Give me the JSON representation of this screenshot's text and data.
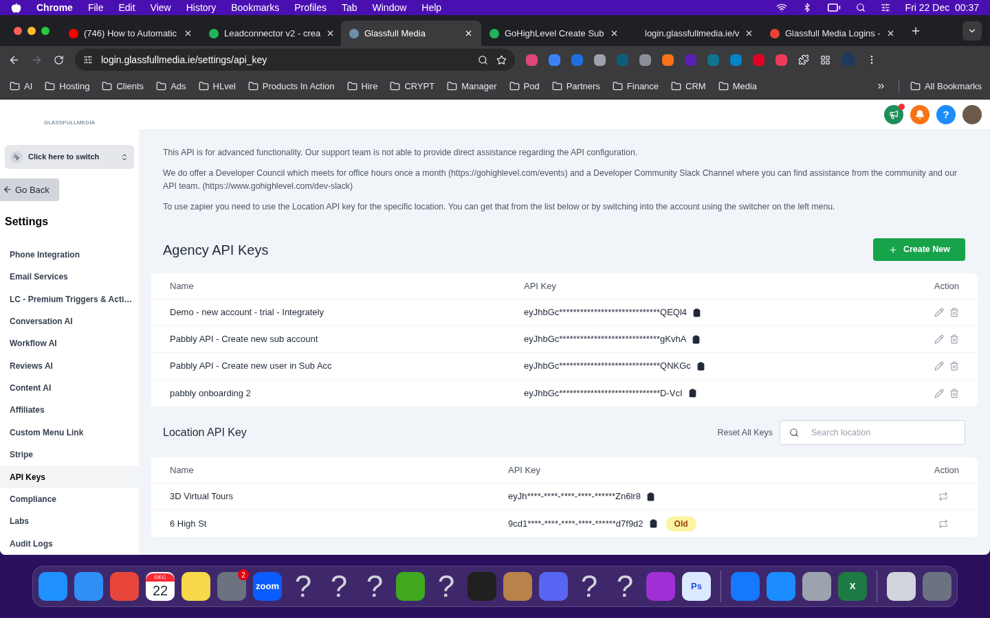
{
  "menu_bar": {
    "app": "Chrome",
    "items": [
      "File",
      "Edit",
      "View",
      "History",
      "Bookmarks",
      "Profiles",
      "Tab",
      "Window",
      "Help"
    ],
    "clock": "Fri 22 Dec  00:37"
  },
  "tabs": [
    {
      "title": "(746) How to Automatic",
      "selected": false,
      "color": "#ff0000"
    },
    {
      "title": "Leadconnector v2 - crea",
      "selected": false,
      "color": "#22b35e"
    },
    {
      "title": "Glassfull Media",
      "selected": true,
      "color": "#6b8fa8"
    },
    {
      "title": "GoHighLevel Create Sub",
      "selected": false,
      "color": "#22b35e"
    },
    {
      "title": "login.glassfullmedia.ie/v",
      "selected": false
    },
    {
      "title": "Glassfull Media Logins -",
      "selected": false,
      "color": "#ea4335"
    }
  ],
  "address": "login.glassfullmedia.ie/settings/api_key",
  "extensions": [
    {
      "color": "#e0457b"
    },
    {
      "color": "#3b82f6"
    },
    {
      "color": "#1d6fe0"
    },
    {
      "color": "#9ca3af"
    },
    {
      "color": "#0f5e78"
    },
    {
      "color": "#8b8f99"
    },
    {
      "color": "#f97316"
    },
    {
      "color": "#5b21b6"
    },
    {
      "color": "#0e7490"
    },
    {
      "color": "#0284c7"
    },
    {
      "color": "#e60023"
    },
    {
      "color": "#ef3b5b"
    }
  ],
  "bookmarks": [
    "AI",
    "Hosting",
    "Clients",
    "Ads",
    "HLvel",
    "Products In Action",
    "Hire",
    "CRYPT",
    "Manager",
    "Pod",
    "Partners",
    "Finance",
    "CRM",
    "Media"
  ],
  "all_bookmarks": "All Bookmarks",
  "sidebar": {
    "logo": "GLASSFULLMEDIA",
    "switcher": "Click here to switch",
    "back": "Go Back",
    "heading": "Settings",
    "items": [
      {
        "label": "Phone Integration",
        "selected": false
      },
      {
        "label": "Email Services",
        "selected": false
      },
      {
        "label": "LC - Premium Triggers & Acti…",
        "selected": false
      },
      {
        "label": "Conversation AI",
        "selected": false
      },
      {
        "label": "Workflow AI",
        "selected": false
      },
      {
        "label": "Reviews AI",
        "selected": false
      },
      {
        "label": "Content AI",
        "selected": false
      },
      {
        "label": "Affiliates",
        "selected": false
      },
      {
        "label": "Custom Menu Link",
        "selected": false
      },
      {
        "label": "Stripe",
        "selected": false
      },
      {
        "label": "API Keys",
        "selected": true
      },
      {
        "label": "Compliance",
        "selected": false
      },
      {
        "label": "Labs",
        "selected": false
      },
      {
        "label": "Audit Logs",
        "selected": false
      }
    ]
  },
  "header": {
    "help": "?",
    "notification_dot": true
  },
  "intro": [
    "This API is for advanced functionality. Our support team is not able to provide direct assistance regarding the API configuration.",
    "We do offer a Developer Council which meets for office hours once a month (https://gohighlevel.com/events) and a Developer Community Slack Channel where you can find assistance from the community and our API team. (https://www.gohighlevel.com/dev-slack)",
    "To use zapier you need to use the Location API key for the specific location. You can get that from the list below or by switching into the account using the switcher on the left menu."
  ],
  "agency": {
    "title": "Agency API Keys",
    "create_button": "Create New",
    "columns": [
      "Name",
      "API Key",
      "Action"
    ],
    "rows": [
      {
        "name": "Demo - new account - trial - Integrately",
        "key": "eyJhbGc*****************************QEQl4"
      },
      {
        "name": "Pabbly API - Create new sub account",
        "key": "eyJhbGc*****************************gKvhA"
      },
      {
        "name": "Pabbly API - Create new user in Sub Acc",
        "key": "eyJhbGc*****************************QNKGc"
      },
      {
        "name": "pabbly onboarding 2",
        "key": "eyJhbGc*****************************D-VcI"
      }
    ]
  },
  "location": {
    "title": "Location API Key",
    "reset": "Reset All Keys",
    "search_placeholder": "Search location",
    "columns": [
      "Name",
      "API Key",
      "Action"
    ],
    "rows": [
      {
        "name": "3D Virtual Tours",
        "key": "eyJh****-****-****-****-******Zn6lr8"
      },
      {
        "name": "6 High St",
        "key": "9cd1****-****-****-****-******d7f9d2",
        "badge": "Old"
      }
    ]
  },
  "dock": [
    {
      "kind": "app",
      "color": "#1e90ff"
    },
    {
      "kind": "app",
      "color": "#2f8ff5"
    },
    {
      "kind": "app",
      "color": "#e8463a"
    },
    {
      "kind": "calendar",
      "month": "DEC",
      "day": "22"
    },
    {
      "kind": "app",
      "color": "#f8d84a"
    },
    {
      "kind": "app",
      "color": "#6b7280",
      "badge": "2"
    },
    {
      "kind": "label",
      "color": "#0b5cff",
      "text": "zoom"
    },
    {
      "kind": "unknown",
      "text": "?"
    },
    {
      "kind": "unknown",
      "text": "?"
    },
    {
      "kind": "unknown",
      "text": "?"
    },
    {
      "kind": "app",
      "color": "#3fa81e"
    },
    {
      "kind": "unknown",
      "text": "?"
    },
    {
      "kind": "app",
      "color": "#202020"
    },
    {
      "kind": "app",
      "color": "#b7834a"
    },
    {
      "kind": "app",
      "color": "#5865f2"
    },
    {
      "kind": "unknown",
      "text": "?"
    },
    {
      "kind": "unknown",
      "text": "?"
    },
    {
      "kind": "app",
      "color": "#a12fd6"
    },
    {
      "kind": "label",
      "color": "#dbeafe",
      "text": "Ps"
    },
    {
      "kind": "divider"
    },
    {
      "kind": "app",
      "color": "#1677ff"
    },
    {
      "kind": "app",
      "color": "#1a8cff"
    },
    {
      "kind": "app",
      "color": "#9ca3af"
    },
    {
      "kind": "label",
      "color": "#1d7a45",
      "text": "X"
    },
    {
      "kind": "divider"
    },
    {
      "kind": "app",
      "color": "#d1d5db"
    },
    {
      "kind": "app",
      "color": "#6b7280"
    }
  ]
}
